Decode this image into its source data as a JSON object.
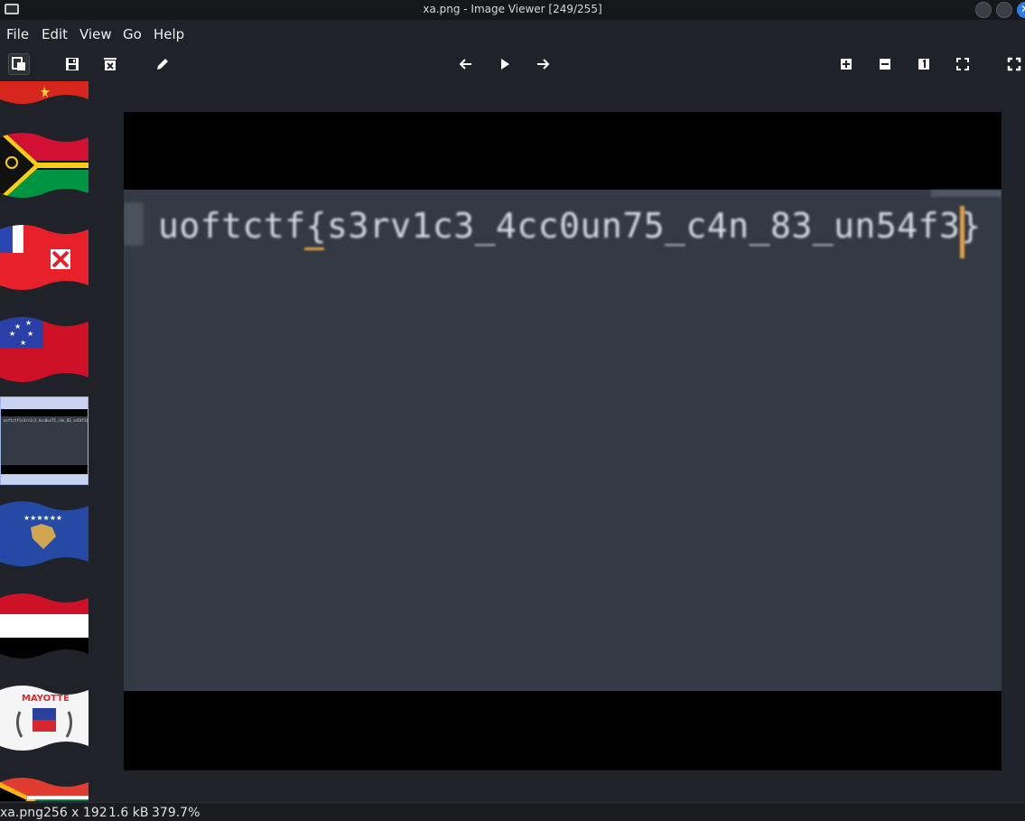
{
  "window": {
    "title": "xa.png - Image Viewer [249/255]"
  },
  "menu": {
    "file": "File",
    "edit": "Edit",
    "view": "View",
    "go": "Go",
    "help": "Help"
  },
  "toolbar": {
    "icons": [
      "show-sidebar-icon",
      "save-icon",
      "delete-icon",
      "edit-icon",
      "previous-icon",
      "slideshow-icon",
      "next-icon",
      "zoom-in-icon",
      "zoom-out-icon",
      "original-size-icon",
      "fit-window-icon",
      "fullscreen-icon"
    ]
  },
  "sidebar": {
    "thumbnails": [
      "flag-vietnam",
      "flag-vanuatu",
      "flag-wallis-futuna",
      "flag-samoa",
      "xa.png",
      "flag-kosovo",
      "flag-yemen",
      "flag-mayotte",
      "flag-south-africa"
    ],
    "mayotte_label": "MAYOTTE",
    "selected_thumb_text": "uoftctf{s3rv1c3_4cc0un75_c4n_83_un54f3}"
  },
  "image": {
    "text": "uoftctf{s3rv1c3_4cc0un75_c4n_83_un54f3}",
    "colors": {
      "background": "#343a43",
      "text": "#d6dbe3",
      "cursor": "#e0a046"
    }
  },
  "status": {
    "filename": "xa.png",
    "dimensions": "256 x 192",
    "size": "1.6 kB",
    "zoom": "379.7%"
  }
}
